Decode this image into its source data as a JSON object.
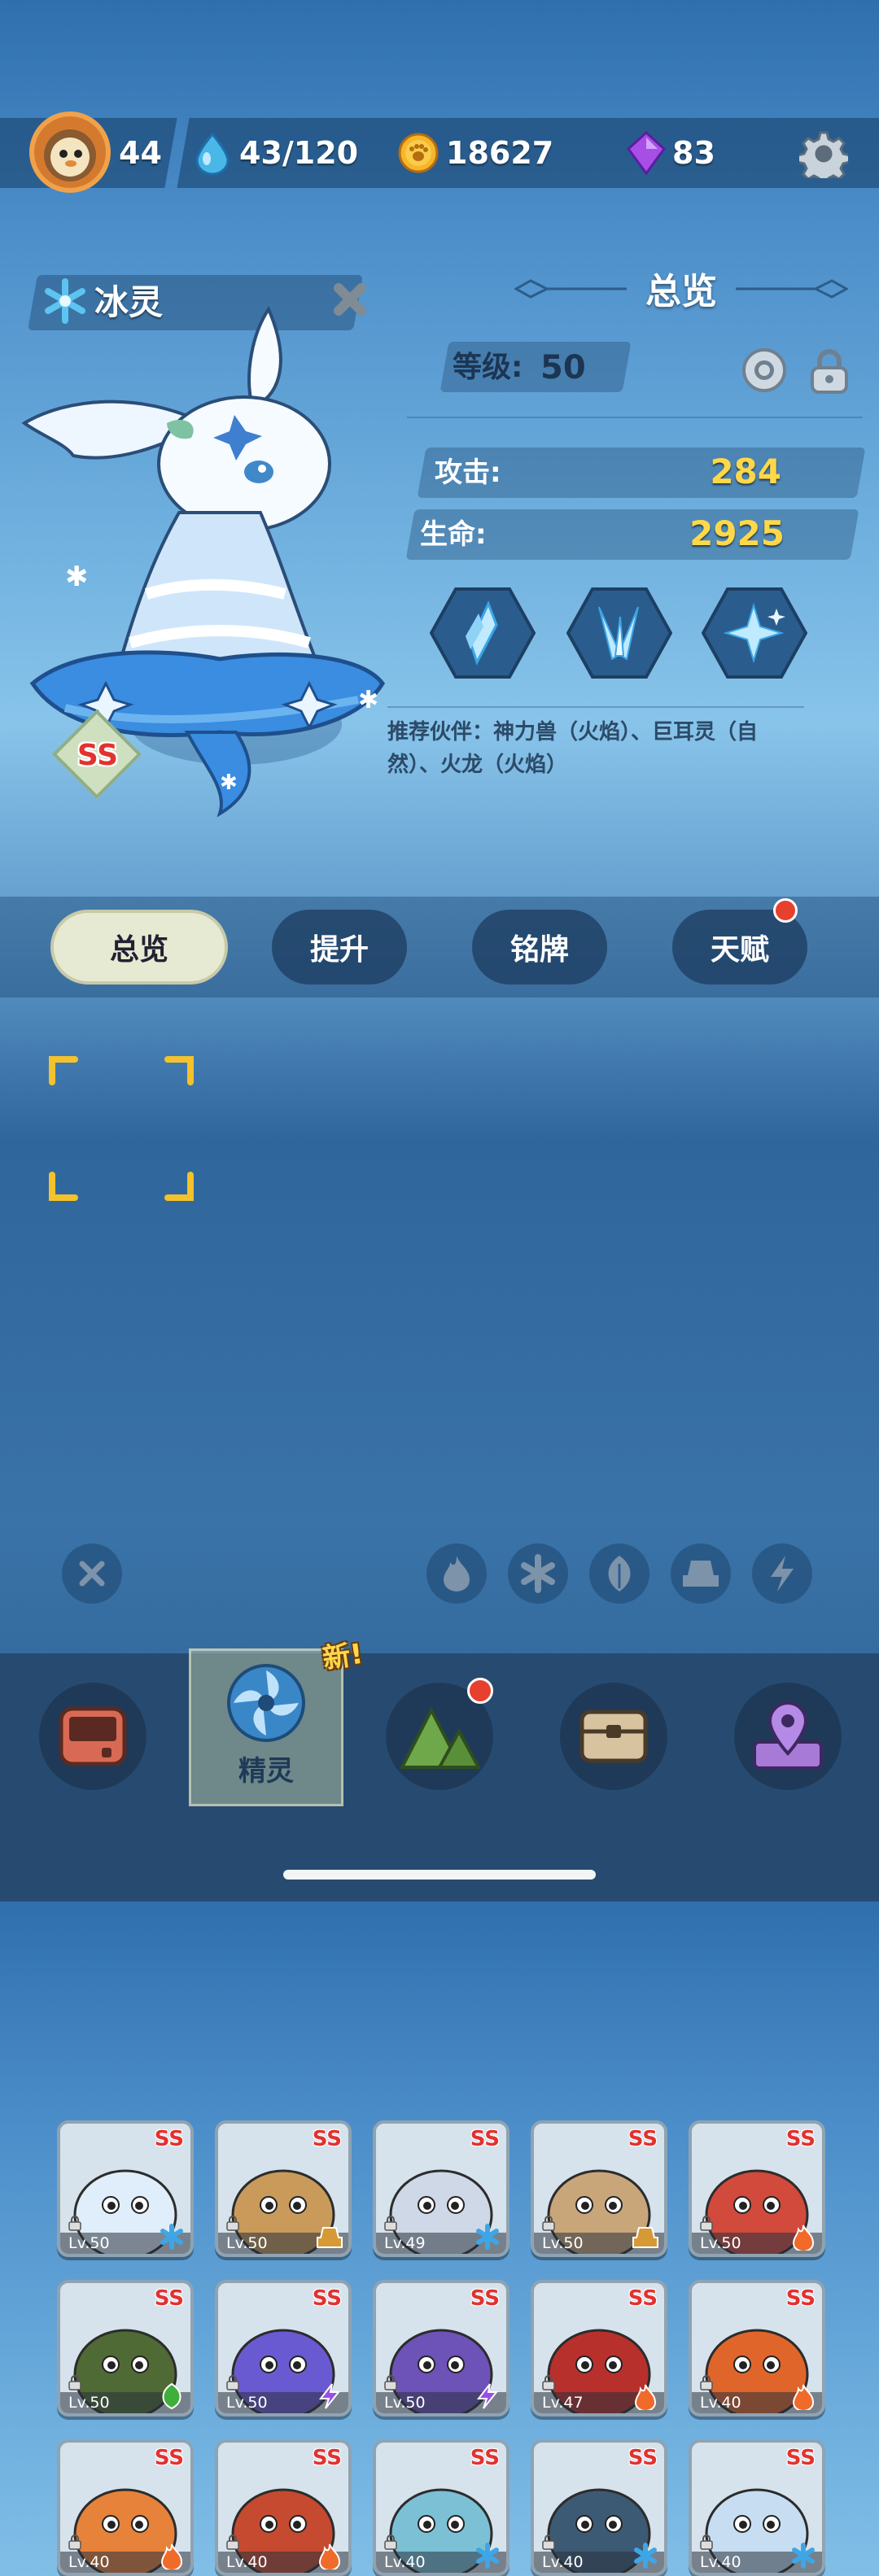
{
  "top_bar": {
    "player_level": "44",
    "energy": "43/120",
    "coins": "18627",
    "gems": "83"
  },
  "pet": {
    "name": "冰灵",
    "rank": "SS",
    "element_icon": "snowflake-icon"
  },
  "overview": {
    "title": "总览",
    "level_label": "等级:",
    "level_value": "50",
    "attack_label": "攻击:",
    "attack_value": "284",
    "hp_label": "生命:",
    "hp_value": "2925",
    "recommend": "推荐伙伴：神力兽（火焰）、巨耳灵（自然）、火龙（火焰）"
  },
  "tabs": [
    {
      "label": "总览",
      "active": true
    },
    {
      "label": "提升",
      "active": false
    },
    {
      "label": "铭牌",
      "active": false
    },
    {
      "label": "天赋",
      "active": false,
      "badge": true
    }
  ],
  "roster": [
    {
      "rank": "SS",
      "level": "Lv.50",
      "element": "ice",
      "color": "#dfeefa"
    },
    {
      "rank": "SS",
      "level": "Lv.50",
      "element": "earth",
      "color": "#c99a5a"
    },
    {
      "rank": "SS",
      "level": "Lv.49",
      "element": "ice",
      "color": "#cfd8e6"
    },
    {
      "rank": "SS",
      "level": "Lv.50",
      "element": "earth",
      "color": "#c9a67a"
    },
    {
      "rank": "SS",
      "level": "Lv.50",
      "element": "fire",
      "color": "#d14a3c"
    },
    {
      "rank": "SS",
      "level": "Lv.50",
      "element": "nature",
      "color": "#4f6a34"
    },
    {
      "rank": "SS",
      "level": "Lv.50",
      "element": "thunder",
      "color": "#6a5ad1"
    },
    {
      "rank": "SS",
      "level": "Lv.50",
      "element": "thunder",
      "color": "#6d52b8"
    },
    {
      "rank": "SS",
      "level": "Lv.47",
      "element": "fire",
      "color": "#b8302c"
    },
    {
      "rank": "SS",
      "level": "Lv.40",
      "element": "fire",
      "color": "#e0652a"
    },
    {
      "rank": "SS",
      "level": "Lv.40",
      "element": "fire",
      "color": "#e6823a"
    },
    {
      "rank": "SS",
      "level": "Lv.40",
      "element": "fire",
      "color": "#c54a30"
    },
    {
      "rank": "SS",
      "level": "Lv.40",
      "element": "ice",
      "color": "#7cc0d6"
    },
    {
      "rank": "SS",
      "level": "Lv.40",
      "element": "ice",
      "color": "#3d5a74"
    },
    {
      "rank": "SS",
      "level": "Lv.40",
      "element": "ice",
      "color": "#c7def2"
    }
  ],
  "filters": [
    "close-icon",
    "fire-icon",
    "ice-icon",
    "nature-icon",
    "earth-icon",
    "thunder-icon"
  ],
  "bottom_nav": {
    "items": [
      {
        "icon": "console-icon"
      },
      {
        "icon": "spirit-icon",
        "label": "精灵",
        "new_badge": "新!",
        "active": true
      },
      {
        "icon": "mountain-icon",
        "dot": true
      },
      {
        "icon": "chest-icon"
      },
      {
        "icon": "map-pin-icon"
      }
    ]
  },
  "colors": {
    "gold_text": "#ffd84a",
    "badge_red": "#e6412e",
    "fire": "#f06a2a",
    "ice": "#3ea6e6",
    "thunder": "#9b4ee6",
    "nature": "#3fae3a",
    "earth": "#d59a36"
  }
}
